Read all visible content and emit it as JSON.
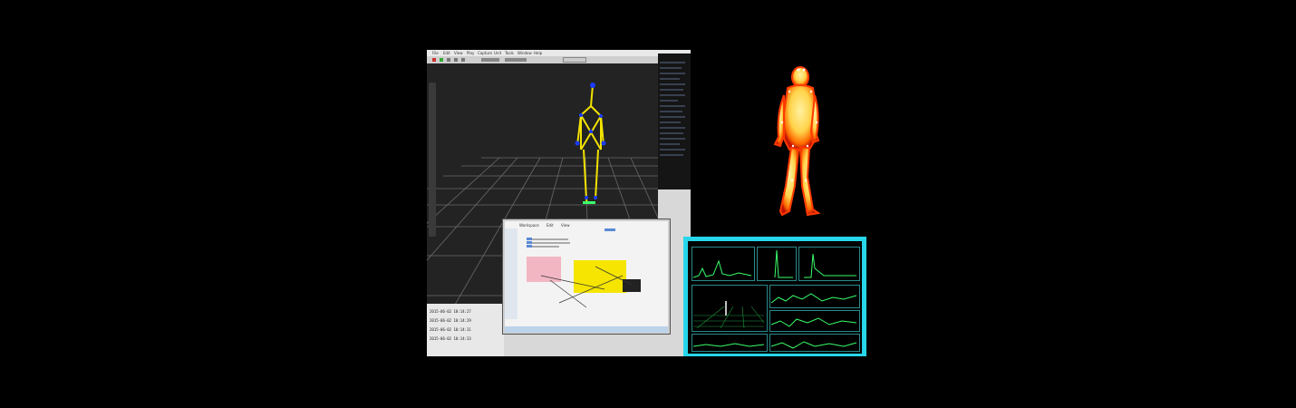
{
  "main_monitor": {
    "menu_items": [
      "File",
      "Edit",
      "View",
      "Play",
      "Capture",
      "Unit",
      "Tools",
      "Window",
      "Help"
    ],
    "log_lines": [
      "2015-06-02 10:14:27",
      "2015-06-02 10:14:29",
      "2015-06-02 10:14:31",
      "2015-06-02 10:14:33"
    ]
  },
  "laptop": {
    "tabs": [
      "Workspace",
      "Edit",
      "View"
    ]
  },
  "colors": {
    "grid": "#6a6a6a",
    "skeleton_bone": "#f2e200",
    "skeleton_marker": "#1a3cff",
    "signal_frame": "#27d6e9",
    "signal_trace": "#39ff6a",
    "thermal_hot": "#fff1a0",
    "thermal_edge": "#ff3a00"
  },
  "icons": [
    "record-icon",
    "play-icon",
    "stop-icon",
    "zoom-icon",
    "pan-icon"
  ]
}
